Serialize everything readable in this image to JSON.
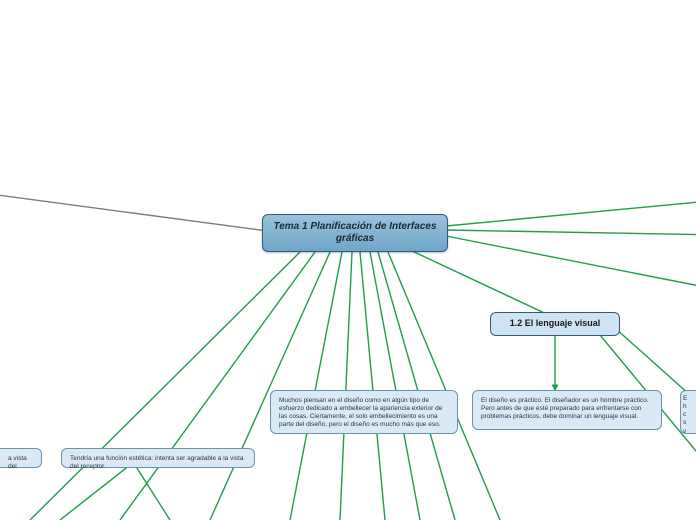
{
  "root": {
    "title": "Tema 1 Planificación de Interfaces gráficas"
  },
  "sub": {
    "lenguaje_visual": "1.2 El lenguaje visual"
  },
  "leaves": {
    "muchos_piensan": "Muchos piensan en el diseño como en algún tipo de esfuerzo dedicado a embellecer la apariencia exterior de las cosas. Ciertamente, el solo embellecimiento es una parte del diseño, pero el diseño es mucho más que eso.",
    "diseno_practico": "El diseño es práctico. El diseñador es un hombre práctico. Pero antes de que esté preparado para enfrentarse con problemas prácticos, debe dominar un lenguaje visual.",
    "funcion_estetica": "Tendría una función estética: intenta ser agradable a la vista del receptor.",
    "vista_del": "a vista del",
    "right_cut_lines": [
      "E",
      "h",
      "c",
      "s",
      "v"
    ]
  },
  "colors": {
    "edge_green": "#1f9e4a",
    "edge_gray": "#7d7d7d",
    "node_fill": "#d9e9f5",
    "node_border": "#6a93af",
    "root_border": "#2f5a78"
  }
}
